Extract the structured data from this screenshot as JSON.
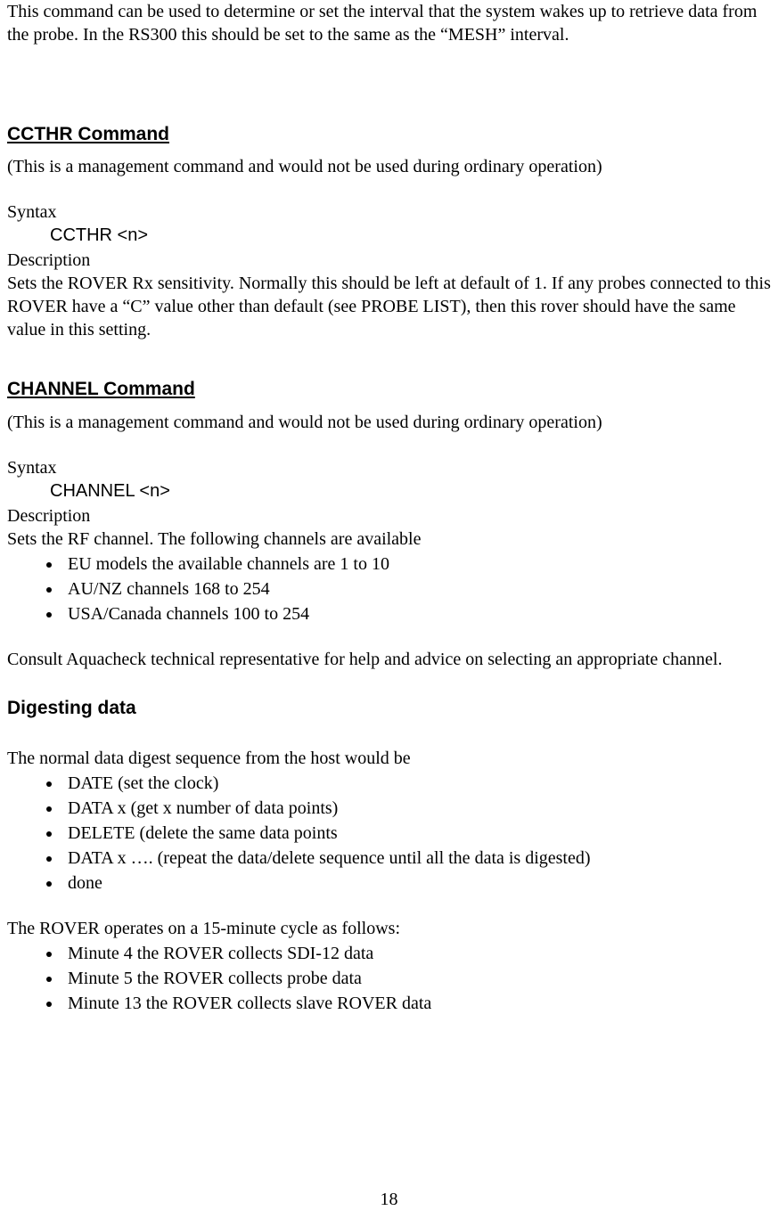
{
  "intro_paragraph": "This command can be used to determine or set the interval that the system wakes up to retrieve data from the probe. In the RS300 this should be set to the same as the “MESH” interval.",
  "ccthr": {
    "heading": "CCTHR Command",
    "note": "(This is a management command and would not be used during ordinary operation)",
    "syntax_label": "Syntax",
    "syntax_line": "CCTHR <n>",
    "description_label": "Description",
    "description_text": "Sets the ROVER Rx sensitivity. Normally this should be left at default of 1. If any probes connected to this ROVER have a “C” value other than default (see PROBE LIST), then this rover should have the same value in this setting."
  },
  "channel": {
    "heading": "CHANNEL Command",
    "note": "(This is a management command and would not be used during ordinary operation)",
    "syntax_label": "Syntax",
    "syntax_line": "CHANNEL <n>",
    "description_label": "Description",
    "description_text": "Sets the RF channel. The following channels are available",
    "bullets": [
      "EU models the available channels are 1 to 10",
      "AU/NZ channels 168 to 254",
      "USA/Canada channels 100 to 254"
    ],
    "advice": "Consult Aquacheck technical representative for help and advice on selecting an appropriate channel."
  },
  "digesting": {
    "heading": "Digesting data",
    "intro": "The normal data digest sequence from the host would be",
    "sequence": [
      "DATE   (set the clock)",
      "DATA x  (get x number of data points)",
      "DELETE  (delete the same data points",
      "DATA x  …. (repeat the data/delete sequence until all the data is digested)",
      "done"
    ],
    "cycle_intro": "The ROVER operates on a 15-minute cycle as follows:",
    "cycle": [
      "Minute 4 the ROVER collects SDI-12 data",
      "Minute 5 the ROVER collects probe data",
      "Minute 13 the ROVER collects slave ROVER data"
    ]
  },
  "page_number": "18"
}
